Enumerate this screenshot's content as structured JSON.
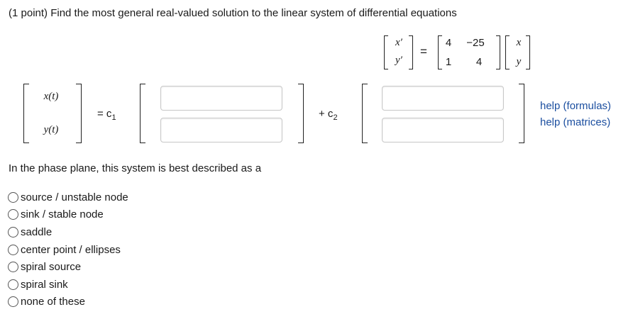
{
  "prompt": "(1 point) Find the most general real-valued solution to the linear system of differential equations",
  "system": {
    "lhs": [
      "x′",
      "y′"
    ],
    "eq": "=",
    "matrix": [
      [
        "4",
        "−25"
      ],
      [
        "1",
        "4"
      ]
    ],
    "rhs": [
      "x",
      "y"
    ]
  },
  "solution": {
    "lhs": [
      "x(t)",
      "y(t)"
    ],
    "eq_c1": "= c",
    "c1_sub": "1",
    "plus_c2": "+ c",
    "c2_sub": "2",
    "inputs": [
      "",
      "",
      "",
      ""
    ]
  },
  "help_links": [
    "help (formulas)",
    "help (matrices)"
  ],
  "question": "In the phase plane, this system is best described as a",
  "options": [
    "source / unstable node",
    "sink / stable node",
    "saddle",
    "center point / ellipses",
    "spiral source",
    "spiral sink",
    "none of these"
  ]
}
